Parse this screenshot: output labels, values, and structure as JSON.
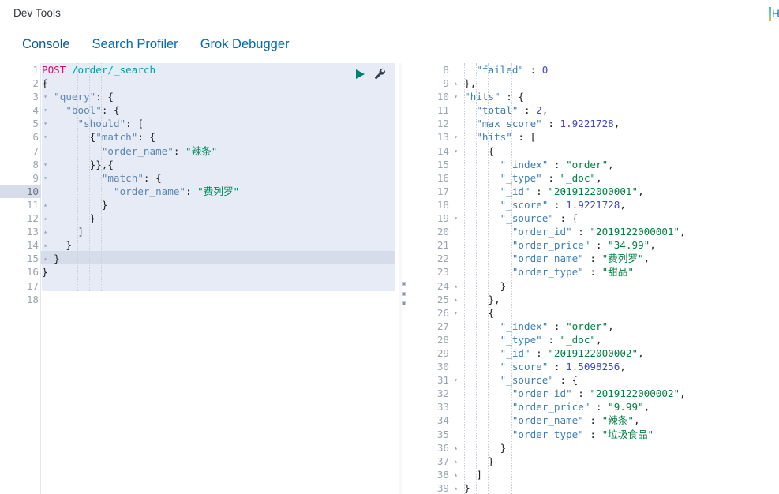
{
  "header": {
    "title": "Dev Tools",
    "right_label": "Help"
  },
  "tabs": [
    {
      "label": "Console",
      "active": true
    },
    {
      "label": "Search Profiler",
      "active": false
    },
    {
      "label": "Grok Debugger",
      "active": false
    }
  ],
  "editor": {
    "actions": [
      {
        "name": "run-request-button",
        "icon": "play-icon",
        "color": "#007f72"
      },
      {
        "name": "wrench-button",
        "icon": "wrench-icon",
        "color": "#34404e"
      }
    ],
    "request_method": "POST",
    "request_path": "/order/_search",
    "active_line": 10,
    "selection_lines": [
      1,
      16
    ],
    "total_lines": 18,
    "lines": [
      {
        "n": 1,
        "fold": "",
        "tokens": [
          {
            "t": "POST",
            "c": "k-method"
          },
          {
            "t": " ",
            "c": ""
          },
          {
            "t": "/order/_search",
            "c": "k-url"
          }
        ]
      },
      {
        "n": 2,
        "fold": "▾",
        "tokens": [
          {
            "t": "{",
            "c": "k-punct"
          }
        ]
      },
      {
        "n": 3,
        "fold": "▾",
        "tokens": [
          {
            "t": "  ",
            "c": ""
          },
          {
            "t": "\"query\"",
            "c": "k-key"
          },
          {
            "t": ": {",
            "c": "k-punct"
          }
        ]
      },
      {
        "n": 4,
        "fold": "▾",
        "tokens": [
          {
            "t": "    ",
            "c": ""
          },
          {
            "t": "\"bool\"",
            "c": "k-key"
          },
          {
            "t": ": {",
            "c": "k-punct"
          }
        ]
      },
      {
        "n": 5,
        "fold": "▾",
        "tokens": [
          {
            "t": "      ",
            "c": ""
          },
          {
            "t": "\"should\"",
            "c": "k-key"
          },
          {
            "t": ": [",
            "c": "k-punct"
          }
        ]
      },
      {
        "n": 6,
        "fold": "▾",
        "tokens": [
          {
            "t": "        {",
            "c": "k-punct"
          },
          {
            "t": "\"match\"",
            "c": "k-key"
          },
          {
            "t": ": {",
            "c": "k-punct"
          }
        ]
      },
      {
        "n": 7,
        "fold": "",
        "tokens": [
          {
            "t": "          ",
            "c": ""
          },
          {
            "t": "\"order_name\"",
            "c": "k-key"
          },
          {
            "t": ": ",
            "c": "k-punct"
          },
          {
            "t": "\"辣条\"",
            "c": "k-str"
          }
        ]
      },
      {
        "n": 8,
        "fold": "▾",
        "tokens": [
          {
            "t": "        }},{",
            "c": "k-punct"
          }
        ]
      },
      {
        "n": 9,
        "fold": "▾",
        "tokens": [
          {
            "t": "          ",
            "c": ""
          },
          {
            "t": "\"match\"",
            "c": "k-key"
          },
          {
            "t": ": {",
            "c": "k-punct"
          }
        ]
      },
      {
        "n": 10,
        "fold": "",
        "tokens": [
          {
            "t": "            ",
            "c": ""
          },
          {
            "t": "\"order_name\"",
            "c": "k-key"
          },
          {
            "t": ": ",
            "c": "k-punct"
          },
          {
            "t": "\"费列罗",
            "c": "k-str"
          },
          {
            "t": "|CARET|",
            "c": "caret-slot"
          },
          {
            "t": "\"",
            "c": "k-str"
          }
        ]
      },
      {
        "n": 11,
        "fold": "▴",
        "tokens": [
          {
            "t": "          }",
            "c": "k-punct"
          }
        ]
      },
      {
        "n": 12,
        "fold": "▴",
        "tokens": [
          {
            "t": "        }",
            "c": "k-punct"
          }
        ]
      },
      {
        "n": 13,
        "fold": "▴",
        "tokens": [
          {
            "t": "      ]",
            "c": "k-punct"
          }
        ]
      },
      {
        "n": 14,
        "fold": "▴",
        "tokens": [
          {
            "t": "    }",
            "c": "k-punct"
          }
        ]
      },
      {
        "n": 15,
        "fold": "▴",
        "tokens": [
          {
            "t": "  }",
            "c": "k-punct"
          }
        ]
      },
      {
        "n": 16,
        "fold": "▴",
        "tokens": [
          {
            "t": "}",
            "c": "k-punct"
          }
        ]
      },
      {
        "n": 17,
        "fold": "",
        "tokens": []
      },
      {
        "n": 18,
        "fold": "",
        "tokens": []
      }
    ]
  },
  "response": {
    "first_visible_line": 8,
    "last_visible_line": 39,
    "lines": [
      {
        "n": 8,
        "fold": "",
        "tokens": [
          {
            "t": "    ",
            "c": ""
          },
          {
            "t": "\"failed\"",
            "c": "k-rkey"
          },
          {
            "t": " : ",
            "c": "k-punct"
          },
          {
            "t": "0",
            "c": "k-rnum"
          }
        ]
      },
      {
        "n": 9,
        "fold": "▴",
        "tokens": [
          {
            "t": "  },",
            "c": "k-punct"
          }
        ]
      },
      {
        "n": 10,
        "fold": "▾",
        "tokens": [
          {
            "t": "  ",
            "c": ""
          },
          {
            "t": "\"hits\"",
            "c": "k-rkey"
          },
          {
            "t": " : {",
            "c": "k-punct"
          }
        ]
      },
      {
        "n": 11,
        "fold": "",
        "tokens": [
          {
            "t": "    ",
            "c": ""
          },
          {
            "t": "\"total\"",
            "c": "k-rkey"
          },
          {
            "t": " : ",
            "c": "k-punct"
          },
          {
            "t": "2",
            "c": "k-rnum"
          },
          {
            "t": ",",
            "c": "k-punct"
          }
        ]
      },
      {
        "n": 12,
        "fold": "",
        "tokens": [
          {
            "t": "    ",
            "c": ""
          },
          {
            "t": "\"max_score\"",
            "c": "k-rkey"
          },
          {
            "t": " : ",
            "c": "k-punct"
          },
          {
            "t": "1.9221728",
            "c": "k-rnum"
          },
          {
            "t": ",",
            "c": "k-punct"
          }
        ]
      },
      {
        "n": 13,
        "fold": "▾",
        "tokens": [
          {
            "t": "    ",
            "c": ""
          },
          {
            "t": "\"hits\"",
            "c": "k-rkey"
          },
          {
            "t": " : [",
            "c": "k-punct"
          }
        ]
      },
      {
        "n": 14,
        "fold": "▾",
        "tokens": [
          {
            "t": "      {",
            "c": "k-punct"
          }
        ]
      },
      {
        "n": 15,
        "fold": "",
        "tokens": [
          {
            "t": "        ",
            "c": ""
          },
          {
            "t": "\"_index\"",
            "c": "k-rkey"
          },
          {
            "t": " : ",
            "c": "k-punct"
          },
          {
            "t": "\"order\"",
            "c": "k-rstr"
          },
          {
            "t": ",",
            "c": "k-punct"
          }
        ]
      },
      {
        "n": 16,
        "fold": "",
        "tokens": [
          {
            "t": "        ",
            "c": ""
          },
          {
            "t": "\"_type\"",
            "c": "k-rkey"
          },
          {
            "t": " : ",
            "c": "k-punct"
          },
          {
            "t": "\"_doc\"",
            "c": "k-rstr"
          },
          {
            "t": ",",
            "c": "k-punct"
          }
        ]
      },
      {
        "n": 17,
        "fold": "",
        "tokens": [
          {
            "t": "        ",
            "c": ""
          },
          {
            "t": "\"_id\"",
            "c": "k-rkey"
          },
          {
            "t": " : ",
            "c": "k-punct"
          },
          {
            "t": "\"2019122000001\"",
            "c": "k-rstr"
          },
          {
            "t": ",",
            "c": "k-punct"
          }
        ]
      },
      {
        "n": 18,
        "fold": "",
        "tokens": [
          {
            "t": "        ",
            "c": ""
          },
          {
            "t": "\"_score\"",
            "c": "k-rkey"
          },
          {
            "t": " : ",
            "c": "k-punct"
          },
          {
            "t": "1.9221728",
            "c": "k-rnum"
          },
          {
            "t": ",",
            "c": "k-punct"
          }
        ]
      },
      {
        "n": 19,
        "fold": "▾",
        "tokens": [
          {
            "t": "        ",
            "c": ""
          },
          {
            "t": "\"_source\"",
            "c": "k-rkey"
          },
          {
            "t": " : {",
            "c": "k-punct"
          }
        ]
      },
      {
        "n": 20,
        "fold": "",
        "tokens": [
          {
            "t": "          ",
            "c": ""
          },
          {
            "t": "\"order_id\"",
            "c": "k-rkey"
          },
          {
            "t": " : ",
            "c": "k-punct"
          },
          {
            "t": "\"2019122000001\"",
            "c": "k-rstr"
          },
          {
            "t": ",",
            "c": "k-punct"
          }
        ]
      },
      {
        "n": 21,
        "fold": "",
        "tokens": [
          {
            "t": "          ",
            "c": ""
          },
          {
            "t": "\"order_price\"",
            "c": "k-rkey"
          },
          {
            "t": " : ",
            "c": "k-punct"
          },
          {
            "t": "\"34.99\"",
            "c": "k-rstr"
          },
          {
            "t": ",",
            "c": "k-punct"
          }
        ]
      },
      {
        "n": 22,
        "fold": "",
        "tokens": [
          {
            "t": "          ",
            "c": ""
          },
          {
            "t": "\"order_name\"",
            "c": "k-rkey"
          },
          {
            "t": " : ",
            "c": "k-punct"
          },
          {
            "t": "\"费列罗\"",
            "c": "k-rstr"
          },
          {
            "t": ",",
            "c": "k-punct"
          }
        ]
      },
      {
        "n": 23,
        "fold": "",
        "tokens": [
          {
            "t": "          ",
            "c": ""
          },
          {
            "t": "\"order_type\"",
            "c": "k-rkey"
          },
          {
            "t": " : ",
            "c": "k-punct"
          },
          {
            "t": "\"甜品\"",
            "c": "k-rstr"
          }
        ]
      },
      {
        "n": 24,
        "fold": "▴",
        "tokens": [
          {
            "t": "        }",
            "c": "k-punct"
          }
        ]
      },
      {
        "n": 25,
        "fold": "▴",
        "tokens": [
          {
            "t": "      },",
            "c": "k-punct"
          }
        ]
      },
      {
        "n": 26,
        "fold": "▾",
        "tokens": [
          {
            "t": "      {",
            "c": "k-punct"
          }
        ]
      },
      {
        "n": 27,
        "fold": "",
        "tokens": [
          {
            "t": "        ",
            "c": ""
          },
          {
            "t": "\"_index\"",
            "c": "k-rkey"
          },
          {
            "t": " : ",
            "c": "k-punct"
          },
          {
            "t": "\"order\"",
            "c": "k-rstr"
          },
          {
            "t": ",",
            "c": "k-punct"
          }
        ]
      },
      {
        "n": 28,
        "fold": "",
        "tokens": [
          {
            "t": "        ",
            "c": ""
          },
          {
            "t": "\"_type\"",
            "c": "k-rkey"
          },
          {
            "t": " : ",
            "c": "k-punct"
          },
          {
            "t": "\"_doc\"",
            "c": "k-rstr"
          },
          {
            "t": ",",
            "c": "k-punct"
          }
        ]
      },
      {
        "n": 29,
        "fold": "",
        "tokens": [
          {
            "t": "        ",
            "c": ""
          },
          {
            "t": "\"_id\"",
            "c": "k-rkey"
          },
          {
            "t": " : ",
            "c": "k-punct"
          },
          {
            "t": "\"2019122000002\"",
            "c": "k-rstr"
          },
          {
            "t": ",",
            "c": "k-punct"
          }
        ]
      },
      {
        "n": 30,
        "fold": "",
        "tokens": [
          {
            "t": "        ",
            "c": ""
          },
          {
            "t": "\"_score\"",
            "c": "k-rkey"
          },
          {
            "t": " : ",
            "c": "k-punct"
          },
          {
            "t": "1.5098256",
            "c": "k-rnum"
          },
          {
            "t": ",",
            "c": "k-punct"
          }
        ]
      },
      {
        "n": 31,
        "fold": "▾",
        "tokens": [
          {
            "t": "        ",
            "c": ""
          },
          {
            "t": "\"_source\"",
            "c": "k-rkey"
          },
          {
            "t": " : {",
            "c": "k-punct"
          }
        ]
      },
      {
        "n": 32,
        "fold": "",
        "tokens": [
          {
            "t": "          ",
            "c": ""
          },
          {
            "t": "\"order_id\"",
            "c": "k-rkey"
          },
          {
            "t": " : ",
            "c": "k-punct"
          },
          {
            "t": "\"2019122000002\"",
            "c": "k-rstr"
          },
          {
            "t": ",",
            "c": "k-punct"
          }
        ]
      },
      {
        "n": 33,
        "fold": "",
        "tokens": [
          {
            "t": "          ",
            "c": ""
          },
          {
            "t": "\"order_price\"",
            "c": "k-rkey"
          },
          {
            "t": " : ",
            "c": "k-punct"
          },
          {
            "t": "\"9.99\"",
            "c": "k-rstr"
          },
          {
            "t": ",",
            "c": "k-punct"
          }
        ]
      },
      {
        "n": 34,
        "fold": "",
        "tokens": [
          {
            "t": "          ",
            "c": ""
          },
          {
            "t": "\"order_name\"",
            "c": "k-rkey"
          },
          {
            "t": " : ",
            "c": "k-punct"
          },
          {
            "t": "\"辣条\"",
            "c": "k-rstr"
          },
          {
            "t": ",",
            "c": "k-punct"
          }
        ]
      },
      {
        "n": 35,
        "fold": "",
        "tokens": [
          {
            "t": "          ",
            "c": ""
          },
          {
            "t": "\"order_type\"",
            "c": "k-rkey"
          },
          {
            "t": " : ",
            "c": "k-punct"
          },
          {
            "t": "\"垃圾食品\"",
            "c": "k-rstr"
          }
        ]
      },
      {
        "n": 36,
        "fold": "▴",
        "tokens": [
          {
            "t": "        }",
            "c": "k-punct"
          }
        ]
      },
      {
        "n": 37,
        "fold": "▴",
        "tokens": [
          {
            "t": "      }",
            "c": "k-punct"
          }
        ]
      },
      {
        "n": 38,
        "fold": "▴",
        "tokens": [
          {
            "t": "    ]",
            "c": "k-punct"
          }
        ]
      },
      {
        "n": 39,
        "fold": "▴",
        "tokens": [
          {
            "t": "  }",
            "c": "k-punct"
          }
        ]
      }
    ]
  },
  "splitter": {
    "name": "panel-splitter",
    "dots": 3
  }
}
